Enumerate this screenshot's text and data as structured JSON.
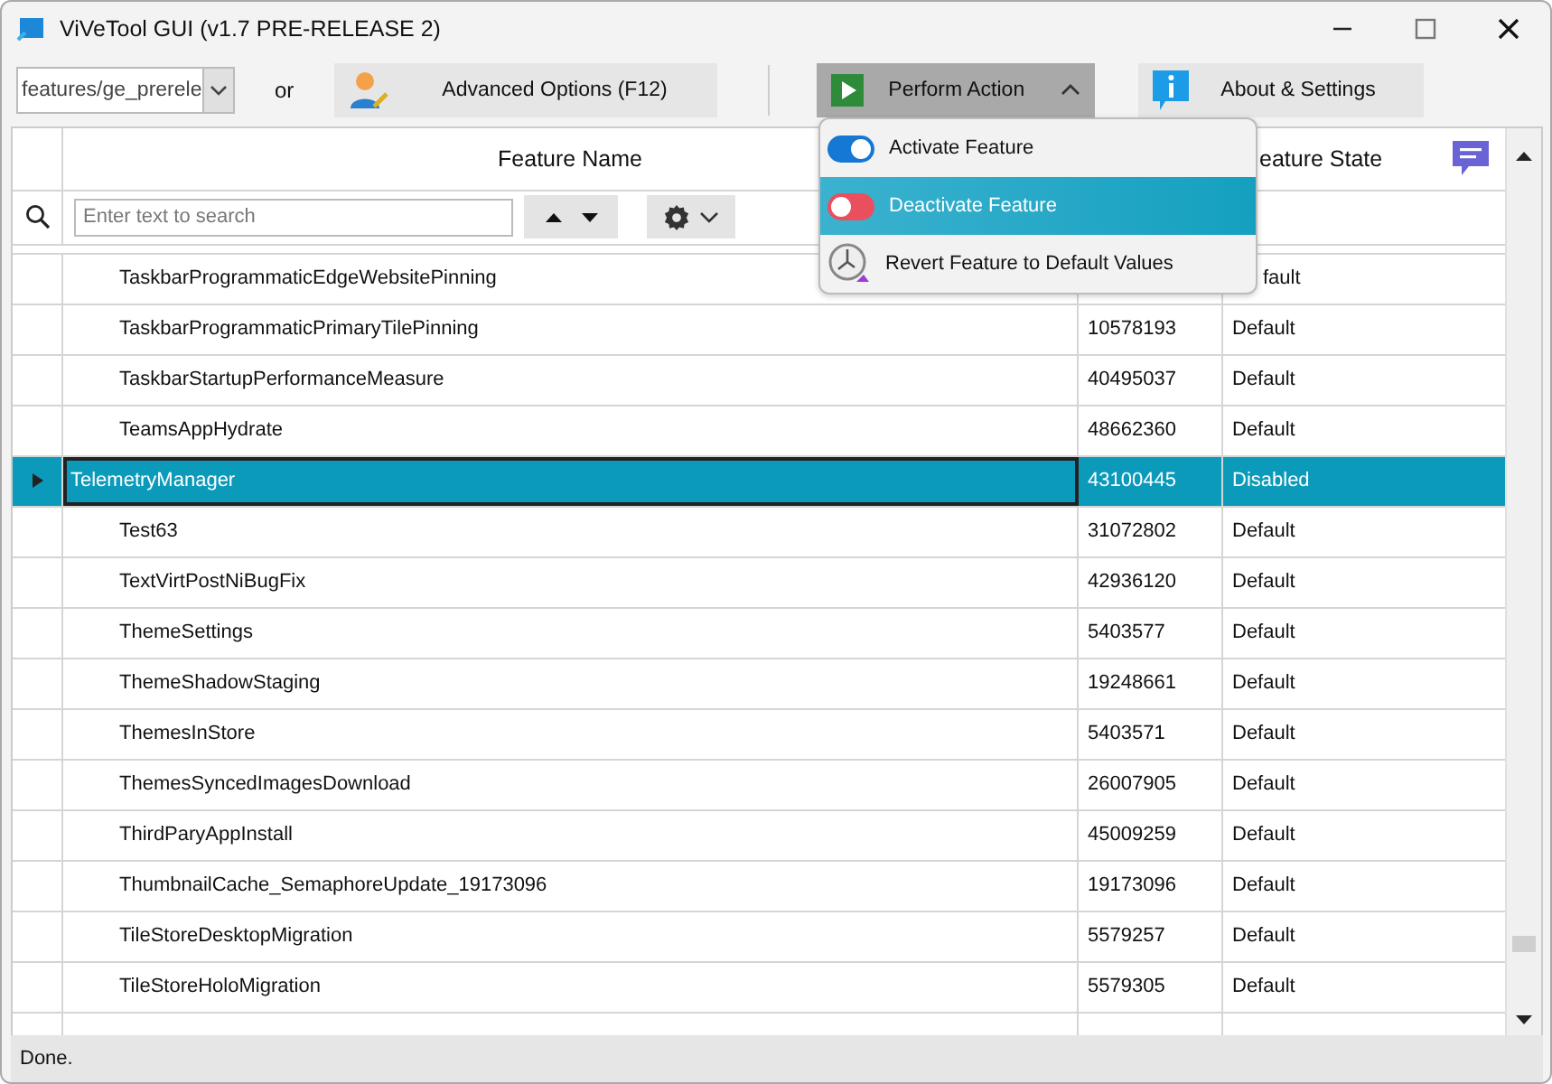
{
  "window": {
    "title": "ViVeTool GUI (v1.7 PRE-RELEASE 2)"
  },
  "toolbar": {
    "branch_combo": {
      "value": "features/ge_prerele"
    },
    "or_label": "or",
    "advanced_button": "Advanced Options (F12)",
    "perform_button": {
      "label": "Perform Action",
      "expanded": true
    },
    "about_button": "About & Settings"
  },
  "action_menu": {
    "items": [
      {
        "label": "Activate Feature",
        "kind": "toggle-on",
        "selected": false
      },
      {
        "label": "Deactivate Feature",
        "kind": "toggle-off",
        "selected": true
      },
      {
        "label": "Revert Feature to Default Values",
        "kind": "revert",
        "selected": false
      }
    ]
  },
  "grid": {
    "columns": [
      {
        "label": "Feature Name"
      },
      {
        "label": "eature State"
      }
    ],
    "search": {
      "placeholder": "Enter text to search"
    },
    "rows": [
      {
        "name": "TaskbarProgrammaticEdgeWebsitePinning",
        "state": "fault",
        "state_covered": true,
        "selected": false
      },
      {
        "name": "TaskbarProgrammaticPrimaryTilePinning",
        "id": "10578193",
        "state": "Default",
        "selected": false
      },
      {
        "name": "TaskbarStartupPerformanceMeasure",
        "id": "40495037",
        "state": "Default",
        "selected": false
      },
      {
        "name": "TeamsAppHydrate",
        "id": "48662360",
        "state": "Default",
        "selected": false
      },
      {
        "name": "TelemetryManager",
        "id": "43100445",
        "state": "Disabled",
        "selected": true
      },
      {
        "name": "Test63",
        "id": "31072802",
        "state": "Default",
        "selected": false
      },
      {
        "name": "TextVirtPostNiBugFix",
        "id": "42936120",
        "state": "Default",
        "selected": false
      },
      {
        "name": "ThemeSettings",
        "id": "5403577",
        "state": "Default",
        "selected": false
      },
      {
        "name": "ThemeShadowStaging",
        "id": "19248661",
        "state": "Default",
        "selected": false
      },
      {
        "name": "ThemesInStore",
        "id": "5403571",
        "state": "Default",
        "selected": false
      },
      {
        "name": "ThemesSyncedImagesDownload",
        "id": "26007905",
        "state": "Default",
        "selected": false
      },
      {
        "name": "ThirdParyAppInstall",
        "id": "45009259",
        "state": "Default",
        "selected": false
      },
      {
        "name": "ThumbnailCache_SemaphoreUpdate_19173096",
        "id": "19173096",
        "state": "Default",
        "selected": false
      },
      {
        "name": "TileStoreDesktopMigration",
        "id": "5579257",
        "state": "Default",
        "selected": false
      },
      {
        "name": "TileStoreHoloMigration",
        "id": "5579305",
        "state": "Default",
        "selected": false
      }
    ]
  },
  "status_bar": "Done."
}
